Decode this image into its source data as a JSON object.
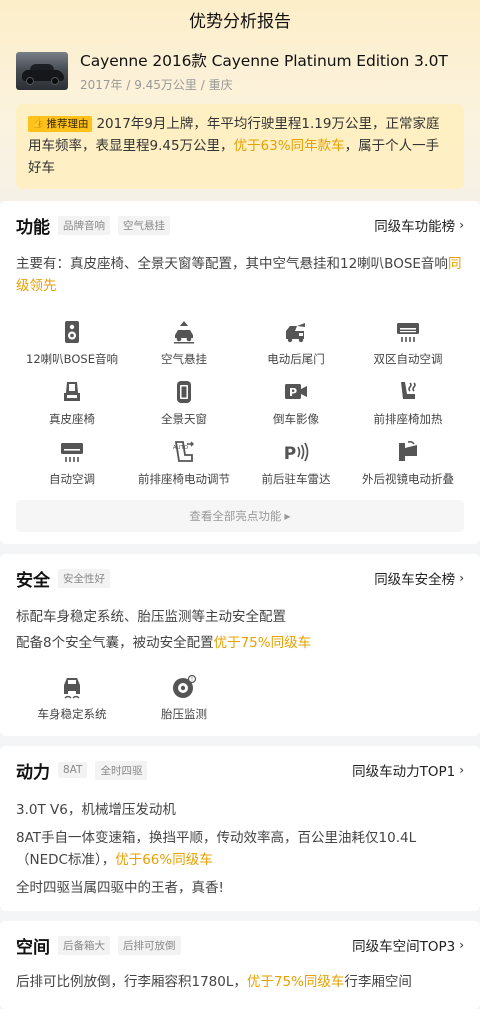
{
  "page": {
    "title": "优势分析报告"
  },
  "car": {
    "name": "Cayenne 2016款 Cayenne Platinum Edition 3.0T",
    "meta": "2017年 / 9.45万公里 / 重庆"
  },
  "reason": {
    "tag": "推荐理由",
    "text_a": "2017年9月上牌，年平均行驶里程1.19万公里，正常家庭用车频率，表显里程9.45万公里，",
    "highlight": "优于63%同年款车",
    "text_b": "，属于个人一手好车"
  },
  "function": {
    "title": "功能",
    "chips": [
      "品牌音响",
      "空气悬挂"
    ],
    "rank": "同级车功能榜",
    "desc_a": "主要有：真皮座椅、全景天窗等配置，其中空气悬挂和12喇叭BOSE音响",
    "desc_hl": "同级领先",
    "features": [
      {
        "icon": "speaker-icon",
        "label": "12喇叭BOSE音响"
      },
      {
        "icon": "air-suspension-icon",
        "label": "空气悬挂"
      },
      {
        "icon": "power-tailgate-icon",
        "label": "电动后尾门"
      },
      {
        "icon": "dual-zone-ac-icon",
        "label": "双区自动空调"
      },
      {
        "icon": "leather-seat-icon",
        "label": "真皮座椅"
      },
      {
        "icon": "panoramic-sunroof-icon",
        "label": "全景天窗"
      },
      {
        "icon": "reverse-camera-icon",
        "label": "倒车影像"
      },
      {
        "icon": "seat-heating-icon",
        "label": "前排座椅加热"
      },
      {
        "icon": "auto-ac-icon",
        "label": "自动空调"
      },
      {
        "icon": "power-seat-adjust-icon",
        "label": "前排座椅电动调节"
      },
      {
        "icon": "parking-radar-icon",
        "label": "前后驻车雷达"
      },
      {
        "icon": "mirror-fold-icon",
        "label": "外后视镜电动折叠"
      }
    ],
    "more": "查看全部亮点功能"
  },
  "safety": {
    "title": "安全",
    "chips": [
      "安全性好"
    ],
    "rank": "同级车安全榜",
    "line1": "标配车身稳定系统、胎压监测等主动安全配置",
    "line2_a": "配备8个安全气囊，被动安全配置",
    "line2_hl": "优于75%同级车",
    "features": [
      {
        "icon": "stability-control-icon",
        "label": "车身稳定系统"
      },
      {
        "icon": "tire-pressure-icon",
        "label": "胎压监测"
      }
    ]
  },
  "power": {
    "title": "动力",
    "chips": [
      "8AT",
      "全时四驱"
    ],
    "rank": "同级车动力TOP1",
    "line1": "3.0T V6，机械增压发动机",
    "line2_a": "8AT手自一体变速箱，换挡平顺，传动效率高，百公里油耗仅10.4L（NEDC标准），",
    "line2_hl": "优于66%同级车",
    "line3": "全时四驱当属四驱中的王者，真香!"
  },
  "space": {
    "title": "空间",
    "chips": [
      "后备箱大",
      "后排可放倒"
    ],
    "rank": "同级车空间TOP3",
    "line_a": "后排可比例放倒，行李厢容积1780L，",
    "line_hl": "优于75%同级车",
    "line_b": "行李厢空间"
  },
  "colors": {
    "highlight": "#e7a100",
    "tag": "#ffc21a",
    "icon": "#555555"
  }
}
